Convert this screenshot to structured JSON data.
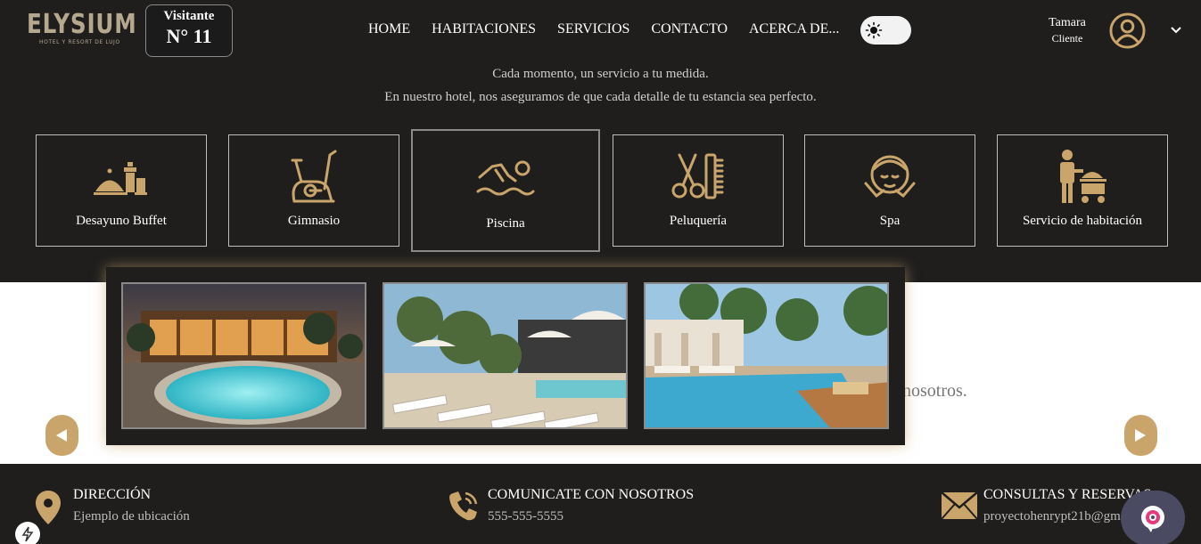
{
  "header": {
    "logo_main": "ELYSIUM",
    "logo_sub": "HOTEL Y RESORT DE LUJO",
    "visitor_label": "Visitante",
    "visitor_number": "N° 11",
    "nav": [
      "HOME",
      "HABITACIONES",
      "SERVICIOS",
      "CONTACTO",
      "ACERCA DE..."
    ],
    "theme_toggle_icon": "sun-icon",
    "user_name": "Tamara",
    "user_role": "Cliente"
  },
  "intro": {
    "line1": "Cada momento, un servicio a tu medida.",
    "line2": "En nuestro hotel, nos aseguramos de que cada detalle de tu estancia sea perfecto."
  },
  "services": [
    {
      "label": "Desayuno Buffet",
      "icon": "buffet-icon"
    },
    {
      "label": "Gimnasio",
      "icon": "bike-icon"
    },
    {
      "label": "Piscina",
      "icon": "swimmer-icon",
      "active": true
    },
    {
      "label": "Peluquería",
      "icon": "scissors-comb-icon"
    },
    {
      "label": "Spa",
      "icon": "spa-face-icon"
    },
    {
      "label": "Servicio de habitación",
      "icon": "room-service-icon"
    }
  ],
  "band": {
    "partial_text": "nosotros."
  },
  "footer": {
    "address_title": "DIRECCIÓN",
    "address_value": "Ejemplo de ubicación",
    "phone_title": "COMUNICATE CON NOSOTROS",
    "phone_value": "555-555-5555",
    "email_title": "CONSULTAS Y RESERVAS",
    "email_value": "proyectohenrypt21b@gmail.com"
  },
  "colors": {
    "accent": "#c9a56b",
    "background": "#1f1e1d"
  }
}
